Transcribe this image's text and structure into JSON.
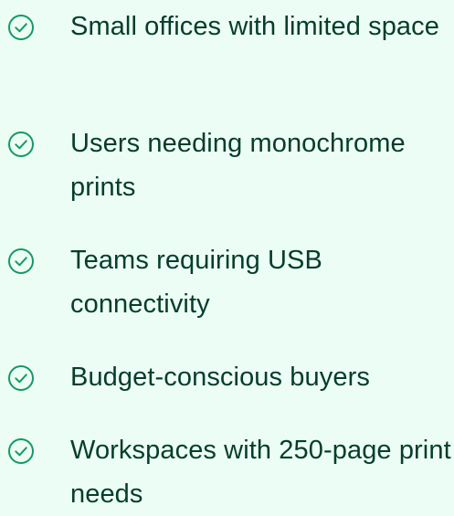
{
  "colors": {
    "background": "#ecfdf5",
    "accent": "#149a63",
    "text": "#053d2c"
  },
  "features": {
    "icon": "check-circle-icon",
    "items": [
      {
        "label": "Small offices with limited space"
      },
      {
        "label": "Users needing monochrome prints"
      },
      {
        "label": "Teams requiring USB connectivity"
      },
      {
        "label": "Budget-conscious buyers"
      },
      {
        "label": "Workspaces with 250-page print needs"
      }
    ]
  }
}
